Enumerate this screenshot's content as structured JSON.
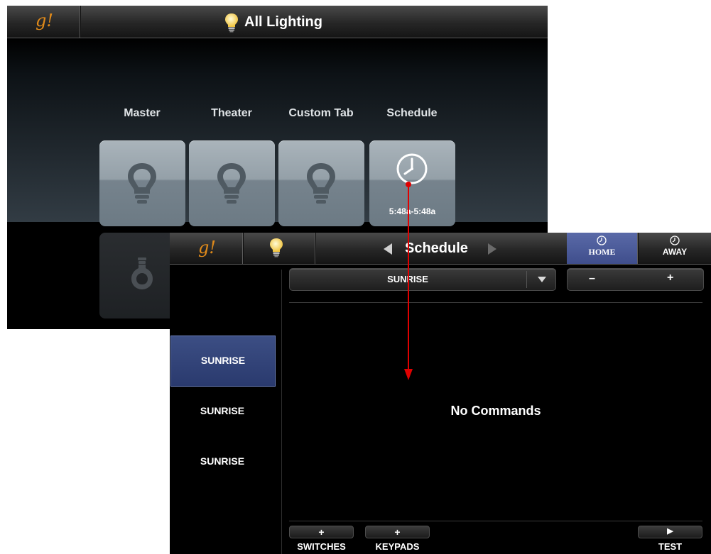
{
  "lighting_screen": {
    "logo": "g!",
    "title": "All Lighting",
    "tabs": [
      {
        "label": "Master",
        "icon": "lightbulb-icon"
      },
      {
        "label": "Theater",
        "icon": "lightbulb-icon"
      },
      {
        "label": "Custom Tab",
        "icon": "lightbulb-icon"
      },
      {
        "label": "Schedule",
        "icon": "clock-icon",
        "time_range": "5:48a-5:48a"
      }
    ]
  },
  "schedule_screen": {
    "logo": "g!",
    "title": "Schedule",
    "modes": [
      {
        "label": "HOME",
        "active": true
      },
      {
        "label": "AWAY",
        "active": false
      }
    ],
    "event_select": {
      "value": "SUNRISE"
    },
    "offset_minus": "–",
    "offset_plus": "+",
    "events": [
      {
        "label": "SUNRISE",
        "selected": true
      },
      {
        "label": "SUNRISE",
        "selected": false
      },
      {
        "label": "SUNRISE",
        "selected": false
      }
    ],
    "empty_message": "No Commands",
    "bottom_buttons": {
      "switches": {
        "icon": "+",
        "label": "SWITCHES"
      },
      "keypads": {
        "icon": "+",
        "label": "KEYPADS"
      },
      "test": {
        "icon": "▶",
        "label": "TEST"
      }
    }
  },
  "colors": {
    "logo_orange": "#e08a1a",
    "selected_blue": "#3c4e84",
    "annotation_arrow": "#e00000"
  }
}
